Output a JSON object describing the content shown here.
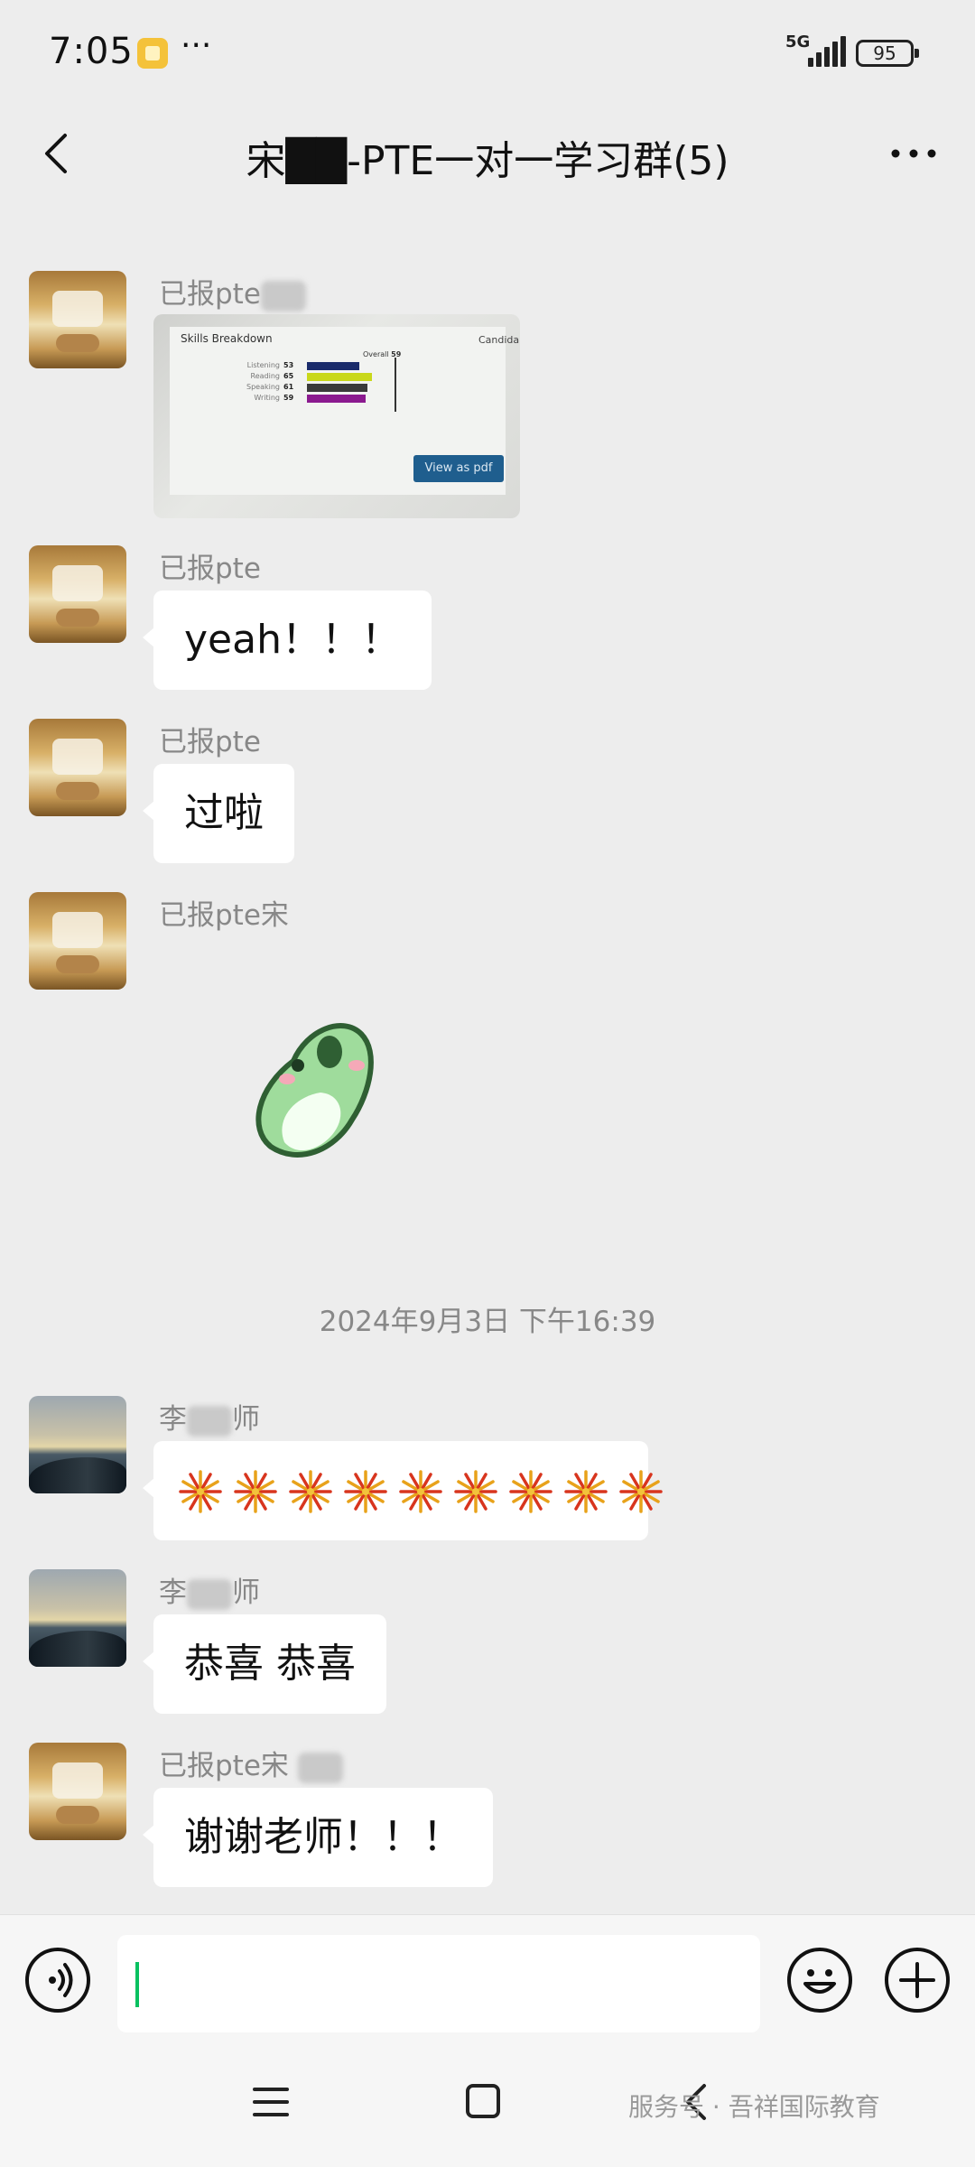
{
  "status_bar": {
    "time": "7:05",
    "dots": "···",
    "network": "5G",
    "battery": "95"
  },
  "nav": {
    "title": "宋██-PTE一对一学习群(5)",
    "more": "···"
  },
  "messages": [
    {
      "sender": "已报pte",
      "type": "image"
    },
    {
      "sender": "已报pte",
      "text": "yeah！！！"
    },
    {
      "sender": "已报pte",
      "text": "过啦"
    },
    {
      "sender": "已报pte宋",
      "type": "sticker"
    },
    {
      "sender_prefix": "李",
      "sender_suffix": "师",
      "type": "fireworks"
    },
    {
      "sender_prefix": "李",
      "sender_suffix": "师",
      "text": "恭喜 恭喜"
    },
    {
      "sender": "已报pte宋",
      "text": "谢谢老师！！！"
    }
  ],
  "image_preview": {
    "heading": "Skills Breakdown",
    "side_heading": "Candida",
    "overall_label": "Overall",
    "overall_value": "59",
    "skills": [
      {
        "label": "Listening",
        "score": "53",
        "color": "#1a2b6b"
      },
      {
        "label": "Reading",
        "score": "65",
        "color": "#c9d81a"
      },
      {
        "label": "Speaking",
        "score": "61",
        "color": "#3a3a3a"
      },
      {
        "label": "Writing",
        "score": "59",
        "color": "#8b1a8f"
      }
    ],
    "button": "View as pdf"
  },
  "timestamp": "2024年9月3日 下午16:39",
  "fireworks_count": 9,
  "watermark": "服务号 · 吾祥国际教育",
  "icons": {
    "back": "chevron-left-icon",
    "more": "more-icon",
    "voice": "voice-icon",
    "emoji": "emoji-icon",
    "plus": "plus-icon"
  }
}
